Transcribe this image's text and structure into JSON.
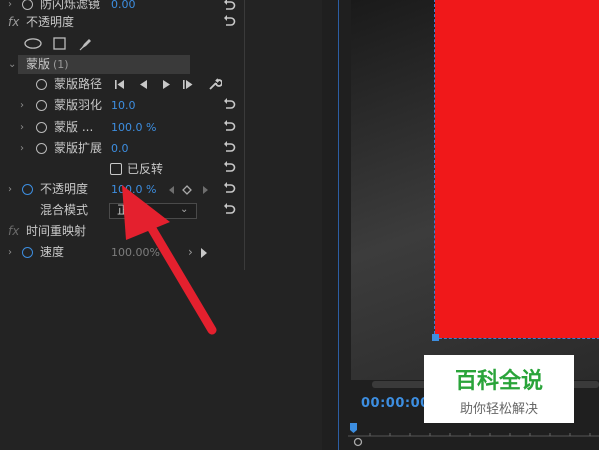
{
  "effects": {
    "top_partial": {
      "label": "防闪烁滤镜",
      "value": "0.00"
    },
    "opacity_section": {
      "fx": "fx",
      "label": "不透明度"
    },
    "mask": {
      "label": "蒙版",
      "count": "(1)"
    },
    "mask_path": {
      "label": "蒙版路径"
    },
    "mask_feather": {
      "label": "蒙版羽化",
      "value": "10.0"
    },
    "mask_opacity": {
      "label": "蒙版 ...",
      "value": "100.0 %"
    },
    "mask_expansion": {
      "label": "蒙版扩展",
      "value": "0.0"
    },
    "inverted": {
      "label": "已反转"
    },
    "opacity": {
      "label": "不透明度",
      "value": "100.0 %"
    },
    "blend_mode": {
      "label": "混合模式",
      "value": "正"
    },
    "time_remap": {
      "fx": "fx",
      "label": "时间重映射"
    },
    "speed": {
      "label": "速度",
      "value": "100.00%"
    }
  },
  "timeline": {
    "timecode": "00:00:00:"
  },
  "watermark": {
    "title": "百科全说",
    "subtitle": "助你轻松解决"
  },
  "colors": {
    "accent": "#3d8ee0",
    "preview_red": "#f0181a",
    "watermark_green": "#2aa43a",
    "arrow_red": "#e4202e"
  }
}
